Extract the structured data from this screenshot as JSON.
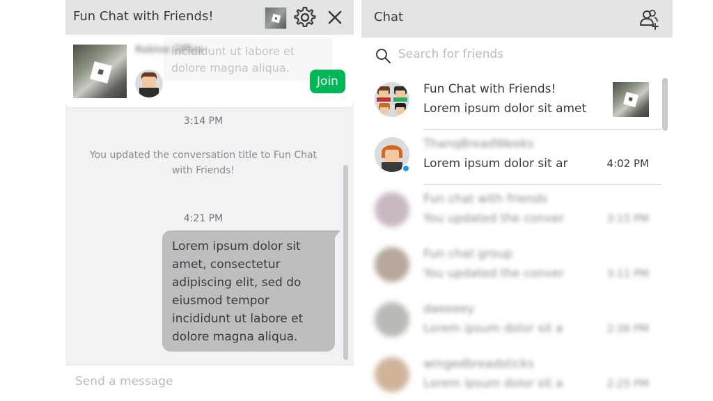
{
  "left": {
    "title": "Fun Chat with Friends!",
    "game": {
      "name": "Roblox Office",
      "preview": "incididunt ut labore et dolore magna aliqua.",
      "join_label": "Join"
    },
    "times": [
      "3:14 PM",
      "4:21 PM"
    ],
    "system_message": "You updated the conversation title to Fun Chat with Friends!",
    "bubble": "Lorem ipsum dolor sit amet, consectetur adipiscing elit, sed do eiusmod tempor incididunt ut labore et dolore magna aliqua.",
    "composer_placeholder": "Send a message"
  },
  "right": {
    "title": "Chat",
    "search_placeholder": "Search for friends",
    "conversations": [
      {
        "name": "Fun Chat with Friends!",
        "preview": "Lorem ipsum dolor sit amet",
        "time": ""
      },
      {
        "name": "ThanqBreadWeeks",
        "preview": "Lorem ipsum dolor sit ar",
        "time": "4:02 PM"
      },
      {
        "name": "Fun chat with friends",
        "preview": "You updated the conver",
        "time": "3:15 PM"
      },
      {
        "name": "Fun chat group",
        "preview": "You updated the conver",
        "time": "3:11 PM"
      },
      {
        "name": "daeeeey",
        "preview": "Lorem ipsum dolor sit a",
        "time": "2:36 PM"
      },
      {
        "name": "wingedbreadsticks",
        "preview": "Lorem ipsum dolor sit a",
        "time": "2:25 PM"
      }
    ]
  },
  "colors": {
    "join": "#02b757",
    "header_bg": "#e3e4e6",
    "bubble_bg": "#bdbec0",
    "online": "#1e90ff"
  },
  "icons": [
    "settings-gear-icon",
    "close-icon",
    "add-friends-icon",
    "search-icon"
  ]
}
